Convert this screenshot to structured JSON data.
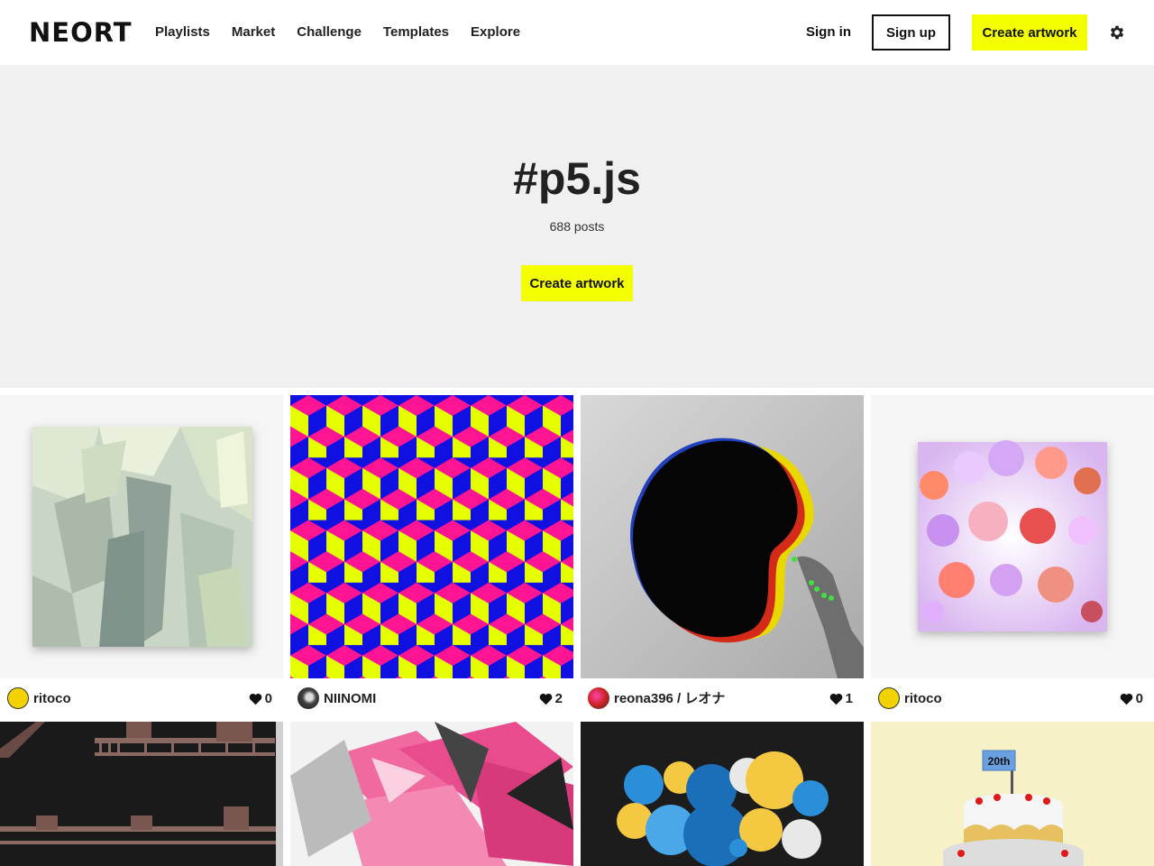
{
  "header": {
    "logo": "NEORT",
    "nav": [
      "Playlists",
      "Market",
      "Challenge",
      "Templates",
      "Explore"
    ],
    "sign_in": "Sign in",
    "sign_up": "Sign up",
    "create": "Create artwork",
    "settings_icon": "gear-icon"
  },
  "hero": {
    "title": "#p5.js",
    "count": "688 posts",
    "create": "Create artwork"
  },
  "artworks": [
    {
      "author": "ritoco",
      "likes": "0"
    },
    {
      "author": "NIINOMI",
      "likes": "2"
    },
    {
      "author": "reona396 / レオナ",
      "likes": "1"
    },
    {
      "author": "ritoco",
      "likes": "0"
    },
    {
      "author": "",
      "likes": ""
    },
    {
      "author": "",
      "likes": ""
    },
    {
      "author": "",
      "likes": ""
    },
    {
      "author": "",
      "likes": ""
    }
  ],
  "colors": {
    "accent": "#f4ff00",
    "hero_bg": "#f0f0f0"
  },
  "artwork_labels": {
    "cake_flag": "20th"
  }
}
